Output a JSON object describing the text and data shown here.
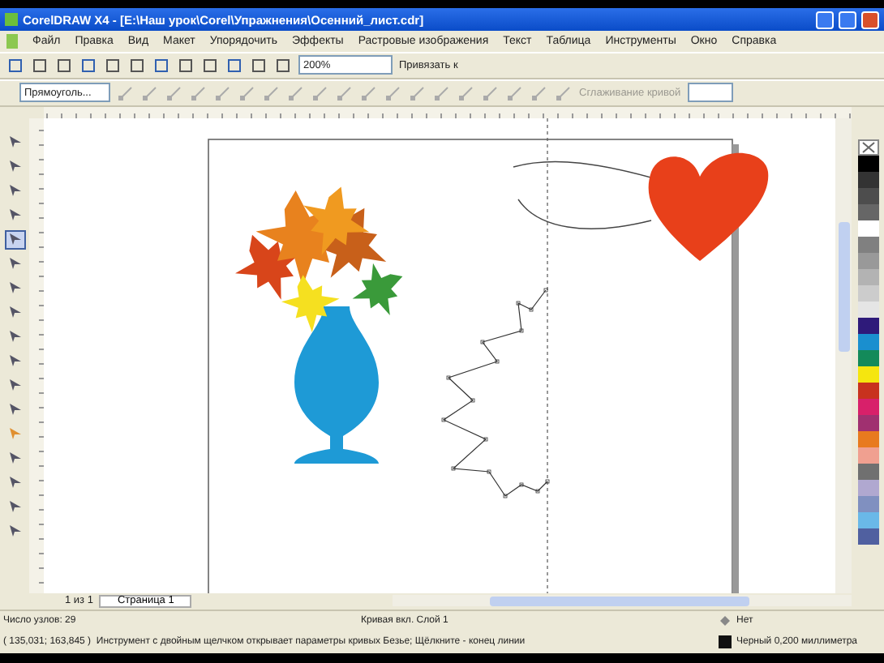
{
  "window": {
    "title": "CorelDRAW X4 - [E:\\Наш урок\\Corel\\Упражнения\\Осенний_лист.cdr]"
  },
  "menu": [
    "Файл",
    "Правка",
    "Вид",
    "Макет",
    "Упорядочить",
    "Эффекты",
    "Растровые изображения",
    "Текст",
    "Таблица",
    "Инструменты",
    "Окно",
    "Справка"
  ],
  "toolbar": {
    "zoom": "200%",
    "snap": "Привязать к"
  },
  "property_bar": {
    "object_type": "Прямоуголь...",
    "smoothing": "Сглаживание кривой"
  },
  "toolbox": [
    {
      "selected": false
    },
    {
      "selected": false
    },
    {
      "selected": false
    },
    {
      "selected": false
    },
    {
      "selected": true
    },
    {
      "selected": false
    },
    {
      "selected": false
    },
    {
      "selected": false
    },
    {
      "selected": false
    },
    {
      "selected": false
    },
    {
      "selected": false
    },
    {
      "selected": false
    },
    {
      "selected": false
    },
    {
      "selected": false
    },
    {
      "selected": false
    },
    {
      "selected": false
    },
    {
      "selected": false
    }
  ],
  "palette": [
    {
      "color": "#000000"
    },
    {
      "color": "#333333"
    },
    {
      "color": "#4d4d4d"
    },
    {
      "color": "#666666"
    },
    {
      "color": "#ffffff"
    },
    {
      "color": "#808080"
    },
    {
      "color": "#999999"
    },
    {
      "color": "#b3b3b3"
    },
    {
      "color": "#cccccc"
    },
    {
      "color": "#e5e5e5"
    },
    {
      "color": "#2e1a7a"
    },
    {
      "color": "#1a8fcf"
    },
    {
      "color": "#138a5a"
    },
    {
      "color": "#f5e60f"
    },
    {
      "color": "#c8321e"
    },
    {
      "color": "#d8206a"
    },
    {
      "color": "#a03070"
    },
    {
      "color": "#e87a1e"
    },
    {
      "color": "#f0a090"
    },
    {
      "color": "#707070"
    },
    {
      "color": "#b0a8d0"
    },
    {
      "color": "#8090c0"
    },
    {
      "color": "#6ab8e8"
    },
    {
      "color": "#5060a0"
    }
  ],
  "page_nav": {
    "count": "1 из 1",
    "tab": "Страница 1"
  },
  "status": {
    "nodes": "Число узлов: 29",
    "object": "Кривая вкл. Слой 1",
    "coords": "( 135,031; 163,845 )",
    "hint": "Инструмент с двойным щелчком открывает параметры кривых Безье; Щёлкните - конец линии",
    "fill": "Нет",
    "outline": "Черный 0,200 миллиметра"
  }
}
